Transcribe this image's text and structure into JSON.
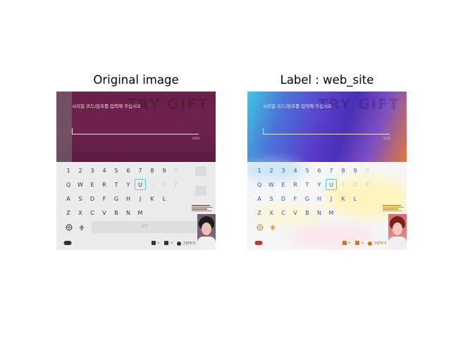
{
  "titles": {
    "left": "Original image",
    "right": "Label : web_site"
  },
  "screen": {
    "instruction": "시리얼 코드/암호를 입력해 주십시오",
    "counter": "0/16",
    "ghost_banner": "TRY GIFT",
    "space_label": "공백",
    "number_row": [
      "1",
      "2",
      "3",
      "4",
      "5",
      "6",
      "7",
      "8",
      "9",
      "0"
    ],
    "row1": [
      "Q",
      "W",
      "E",
      "R",
      "T",
      "Y",
      "U",
      "I",
      "O",
      "P"
    ],
    "row2": [
      "A",
      "S",
      "D",
      "F",
      "G",
      "H",
      "J",
      "K",
      "L"
    ],
    "row3": [
      "Z",
      "X",
      "C",
      "V",
      "B",
      "N",
      "M"
    ],
    "selected_key": "U",
    "hints": {
      "prev_label": "←",
      "next_label": "→",
      "close_label": "그만두기"
    }
  },
  "colors": {
    "selection": "#52d3d8",
    "left_background": "#6d2249",
    "keyboard_background": "#ececec"
  },
  "icons": {
    "globe": "globe-icon",
    "shift": "shift-icon",
    "controller": "controller-icon",
    "webcam": "webcam-overlay"
  }
}
